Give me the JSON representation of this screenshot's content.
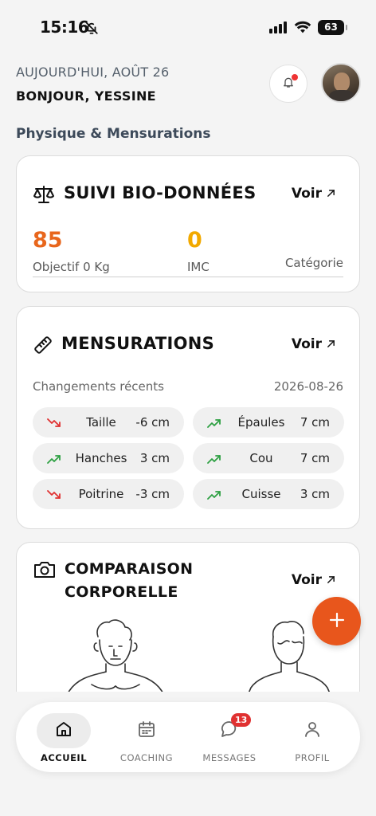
{
  "status_bar": {
    "time": "15:16",
    "battery": "63"
  },
  "header": {
    "date_label": "AUJOURD'HUI, AOÛT 26",
    "greeting": "BONJOUR, YESSINE"
  },
  "section_title": "Physique & Mensurations",
  "bio_card": {
    "title": "SUIVI BIO-DONNÉES",
    "voir_label": "Voir",
    "weight_value": "85",
    "weight_caption": "Objectif 0 Kg",
    "imc_value": "0",
    "imc_caption": "IMC",
    "category_caption": "Catégorie",
    "colors": {
      "weight": "#e8661c",
      "imc": "#f2a900"
    }
  },
  "measurements_card": {
    "title": "MENSURATIONS",
    "voir_label": "Voir",
    "recent_label": "Changements récents",
    "recent_date": "2026-08-26",
    "items": [
      {
        "name": "Taille",
        "value": "-6 cm",
        "trend": "down"
      },
      {
        "name": "Épaules",
        "value": "7 cm",
        "trend": "up"
      },
      {
        "name": "Hanches",
        "value": "3 cm",
        "trend": "up"
      },
      {
        "name": "Cou",
        "value": "7 cm",
        "trend": "up"
      },
      {
        "name": "Poitrine",
        "value": "-3 cm",
        "trend": "down"
      },
      {
        "name": "Cuisse",
        "value": "3 cm",
        "trend": "up"
      }
    ],
    "colors": {
      "up": "#2ea043",
      "down": "#e03131"
    }
  },
  "comparison_card": {
    "title_line1": "COMPARAISON",
    "title_line2": "CORPORELLE",
    "voir_label": "Voir"
  },
  "fab": {
    "icon": "plus-icon",
    "color": "#e8561c"
  },
  "tabbar": {
    "tabs": [
      {
        "label": "ACCUEIL",
        "icon": "home-icon",
        "active": true
      },
      {
        "label": "COACHING",
        "icon": "calendar-icon",
        "active": false
      },
      {
        "label": "MESSAGES",
        "icon": "chat-icon",
        "active": false,
        "badge": "13"
      },
      {
        "label": "PROFIL",
        "icon": "user-icon",
        "active": false
      }
    ]
  }
}
